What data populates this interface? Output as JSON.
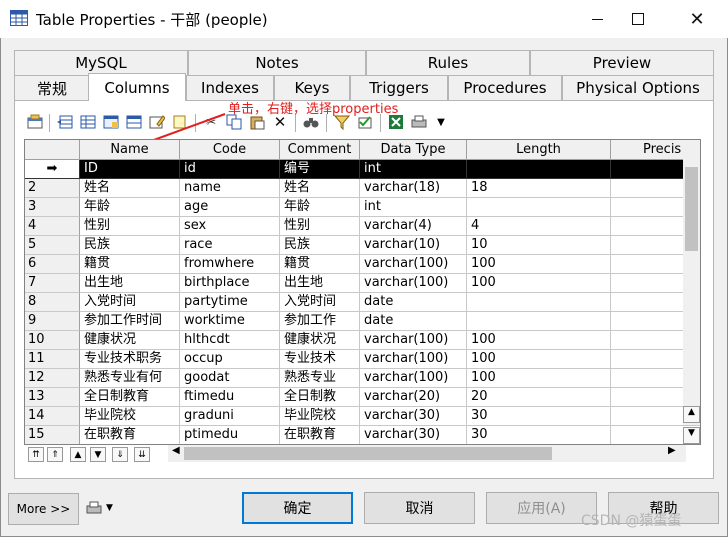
{
  "window": {
    "title": "Table Properties - 干部 (people)"
  },
  "tabs_row1": [
    {
      "label": "MySQL"
    },
    {
      "label": "Notes"
    },
    {
      "label": "Rules"
    },
    {
      "label": "Preview"
    }
  ],
  "tabs_row2": [
    {
      "label": "常规"
    },
    {
      "label": "Columns"
    },
    {
      "label": "Indexes"
    },
    {
      "label": "Keys"
    },
    {
      "label": "Triggers"
    },
    {
      "label": "Procedures"
    },
    {
      "label": "Physical Options"
    }
  ],
  "active_tab": "Columns",
  "annotation": "单击，右键，选择properties",
  "grid": {
    "headers": [
      "Name",
      "Code",
      "Comment",
      "Data Type",
      "Length",
      "Precis"
    ],
    "rows": [
      {
        "num": "",
        "marker": "➡",
        "name": "ID",
        "code": "id",
        "comment": "编号",
        "type": "int",
        "length": ""
      },
      {
        "num": "2",
        "name": "姓名",
        "code": "name",
        "comment": "姓名",
        "type": "varchar(18)",
        "length": "18"
      },
      {
        "num": "3",
        "name": "年龄",
        "code": "age",
        "comment": "年龄",
        "type": "int",
        "length": ""
      },
      {
        "num": "4",
        "name": "性别",
        "code": "sex",
        "comment": "性别",
        "type": "varchar(4)",
        "length": "4"
      },
      {
        "num": "5",
        "name": "民族",
        "code": "race",
        "comment": "民族",
        "type": "varchar(10)",
        "length": "10"
      },
      {
        "num": "6",
        "name": "籍贯",
        "code": "fromwhere",
        "comment": "籍贯",
        "type": "varchar(100)",
        "length": "100"
      },
      {
        "num": "7",
        "name": "出生地",
        "code": "birthplace",
        "comment": "出生地",
        "type": "varchar(100)",
        "length": "100"
      },
      {
        "num": "8",
        "name": "入党时间",
        "code": "partytime",
        "comment": "入党时间",
        "type": "date",
        "length": ""
      },
      {
        "num": "9",
        "name": "参加工作时间",
        "code": "worktime",
        "comment": "参加工作",
        "type": "date",
        "length": ""
      },
      {
        "num": "10",
        "name": "健康状况",
        "code": "hlthcdt",
        "comment": "健康状况",
        "type": "varchar(100)",
        "length": "100"
      },
      {
        "num": "11",
        "name": "专业技术职务",
        "code": "occup",
        "comment": "专业技术",
        "type": "varchar(100)",
        "length": "100"
      },
      {
        "num": "12",
        "name": "熟悉专业有何",
        "code": "goodat",
        "comment": "熟悉专业",
        "type": "varchar(100)",
        "length": "100"
      },
      {
        "num": "13",
        "name": "全日制教育",
        "code": "ftimedu",
        "comment": "全日制教",
        "type": "varchar(20)",
        "length": "20"
      },
      {
        "num": "14",
        "name": "毕业院校",
        "code": "graduni",
        "comment": "毕业院校",
        "type": "varchar(30)",
        "length": "30"
      },
      {
        "num": "15",
        "name": "在职教育",
        "code": "ptimedu",
        "comment": "在职教育",
        "type": "varchar(30)",
        "length": "30"
      }
    ]
  },
  "buttons": {
    "more": "More >>",
    "ok": "确定",
    "cancel": "取消",
    "apply": "应用(A)",
    "help": "帮助"
  },
  "watermark": "CSDN @猿蛋蛋",
  "icons": [
    "table-icon",
    "minimize-icon",
    "maximize-icon",
    "close-icon",
    "properties-icon",
    "insert-row-icon",
    "add-row-icon",
    "add-columns-icon",
    "paste-icon",
    "cut-icon",
    "copy-icon",
    "delete-icon",
    "find-icon",
    "filter-icon",
    "customize-icon",
    "excel-icon",
    "print-icon"
  ]
}
